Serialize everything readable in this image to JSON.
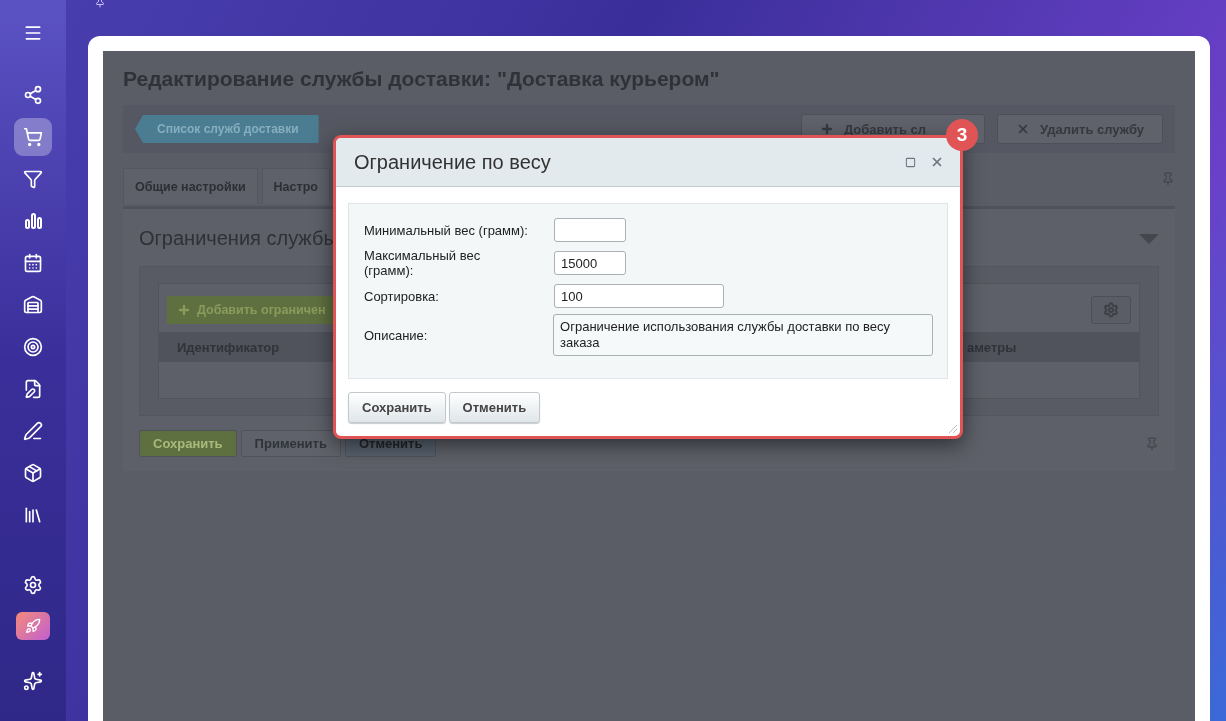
{
  "sidebar": {
    "items": [
      {
        "kind": "menu",
        "selected": false
      },
      {
        "kind": "nodes",
        "selected": false
      },
      {
        "kind": "cart",
        "selected": true
      },
      {
        "kind": "funnel",
        "selected": false
      },
      {
        "kind": "chart",
        "selected": false
      },
      {
        "kind": "calendar",
        "selected": false
      },
      {
        "kind": "warehouse",
        "selected": false
      },
      {
        "kind": "target",
        "selected": false
      },
      {
        "kind": "document",
        "selected": false
      },
      {
        "kind": "pen",
        "selected": false
      },
      {
        "kind": "box",
        "selected": false
      },
      {
        "kind": "library",
        "selected": false
      },
      {
        "kind": "settings",
        "selected": false
      },
      {
        "kind": "rocket",
        "selected": false
      },
      {
        "kind": "sparkles",
        "selected": false
      }
    ]
  },
  "page": {
    "title": "Редактирование службы доставки: \"Доставка курьером\"",
    "back_button": "Список служб доставки",
    "toolbar_buttons": [
      {
        "kind": "add",
        "label": "Добавить сл"
      },
      {
        "kind": "delete",
        "label": "Удалить службу"
      }
    ],
    "tabs": [
      {
        "label": "Общие настройки"
      },
      {
        "label": "Настро"
      }
    ],
    "section_title": "Ограничения службы",
    "add_button": "Добавить ограничен",
    "columns": [
      "Идентификатор",
      "аметры"
    ],
    "footer_buttons": [
      {
        "kind": "primary",
        "label": "Сохранить"
      },
      {
        "kind": "plain",
        "label": "Применить"
      },
      {
        "kind": "blue",
        "label": "Отменить"
      }
    ]
  },
  "dialog": {
    "title": "Ограничение по весу",
    "step_badge": "3",
    "fields": [
      {
        "kind": "short",
        "label": "Минимальный вес (грамм):"
      },
      {
        "kind": "short",
        "label": "Максимальный вес (грамм):",
        "value": "15000"
      },
      {
        "kind": "medium",
        "label": "Сортировка:",
        "value": "100"
      },
      {
        "kind": "textarea",
        "label": "Описание:",
        "value": "Ограничение использования службы доставки по весу заказа"
      }
    ],
    "buttons": [
      "Сохранить",
      "Отменить"
    ]
  }
}
